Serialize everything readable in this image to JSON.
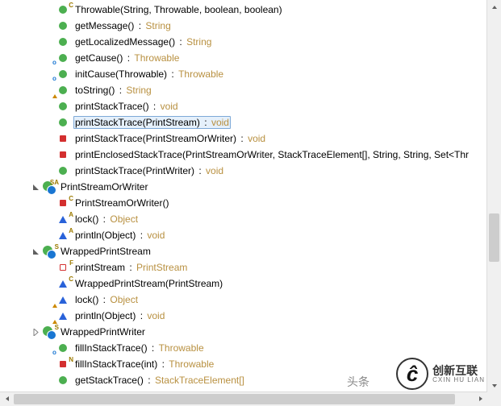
{
  "items": [
    {
      "indent": 3,
      "expand": "",
      "icons": [
        {
          "t": "green",
          "sup": "C"
        }
      ],
      "name": "Throwable(String, Throwable, boolean, boolean)",
      "ret": ""
    },
    {
      "indent": 3,
      "expand": "",
      "icons": [
        {
          "t": "green"
        }
      ],
      "name": "getMessage()",
      "ret": "String"
    },
    {
      "indent": 3,
      "expand": "",
      "icons": [
        {
          "t": "green"
        }
      ],
      "name": "getLocalizedMessage()",
      "ret": "String"
    },
    {
      "indent": 3,
      "expand": "",
      "icons": [
        {
          "t": "green",
          "subO": true
        }
      ],
      "name": "getCause()",
      "ret": "Throwable"
    },
    {
      "indent": 3,
      "expand": "",
      "icons": [
        {
          "t": "green",
          "subO": true
        }
      ],
      "name": "initCause(Throwable)",
      "ret": "Throwable"
    },
    {
      "indent": 3,
      "expand": "",
      "icons": [
        {
          "t": "green",
          "subTri": true
        }
      ],
      "name": "toString()",
      "ret": "String"
    },
    {
      "indent": 3,
      "expand": "",
      "icons": [
        {
          "t": "green"
        }
      ],
      "name": "printStackTrace()",
      "ret": "void"
    },
    {
      "indent": 3,
      "expand": "",
      "icons": [
        {
          "t": "green"
        }
      ],
      "name": "printStackTrace(PrintStream)",
      "ret": "void",
      "selected": true
    },
    {
      "indent": 3,
      "expand": "",
      "icons": [
        {
          "t": "red"
        }
      ],
      "name": "printStackTrace(PrintStreamOrWriter)",
      "ret": "void"
    },
    {
      "indent": 3,
      "expand": "",
      "icons": [
        {
          "t": "red"
        }
      ],
      "name": "printEnclosedStackTrace(PrintStreamOrWriter, StackTraceElement[], String, String, Set<Thr",
      "ret": ""
    },
    {
      "indent": 3,
      "expand": "",
      "icons": [
        {
          "t": "green"
        }
      ],
      "name": "printStackTrace(PrintWriter)",
      "ret": "void"
    },
    {
      "indent": 2,
      "expand": "open",
      "icons": [
        {
          "t": "class",
          "sup": "SA"
        }
      ],
      "name": "PrintStreamOrWriter",
      "ret": ""
    },
    {
      "indent": 3,
      "expand": "",
      "icons": [
        {
          "t": "red",
          "sup": "C"
        }
      ],
      "name": "PrintStreamOrWriter()",
      "ret": ""
    },
    {
      "indent": 3,
      "expand": "",
      "icons": [
        {
          "t": "bluetri",
          "sup": "A"
        }
      ],
      "name": "lock()",
      "ret": "Object"
    },
    {
      "indent": 3,
      "expand": "",
      "icons": [
        {
          "t": "bluetri",
          "sup": "A"
        }
      ],
      "name": "println(Object)",
      "ret": "void"
    },
    {
      "indent": 2,
      "expand": "open",
      "icons": [
        {
          "t": "class",
          "sup": "S"
        }
      ],
      "name": "WrappedPrintStream",
      "ret": ""
    },
    {
      "indent": 3,
      "expand": "",
      "icons": [
        {
          "t": "redsq",
          "sup": "F"
        }
      ],
      "name": "printStream",
      "ret": "PrintStream"
    },
    {
      "indent": 3,
      "expand": "",
      "icons": [
        {
          "t": "bluetri",
          "sup": "C"
        }
      ],
      "name": "WrappedPrintStream(PrintStream)",
      "ret": ""
    },
    {
      "indent": 3,
      "expand": "",
      "icons": [
        {
          "t": "bluetri",
          "subTri": true
        }
      ],
      "name": "lock()",
      "ret": "Object"
    },
    {
      "indent": 3,
      "expand": "",
      "icons": [
        {
          "t": "bluetri",
          "subTri": true
        }
      ],
      "name": "println(Object)",
      "ret": "void"
    },
    {
      "indent": 2,
      "expand": "closed",
      "icons": [
        {
          "t": "class",
          "sup": "S"
        }
      ],
      "name": "WrappedPrintWriter",
      "ret": ""
    },
    {
      "indent": 3,
      "expand": "",
      "icons": [
        {
          "t": "green",
          "subO": true
        }
      ],
      "name": "fillInStackTrace()",
      "ret": "Throwable"
    },
    {
      "indent": 3,
      "expand": "",
      "icons": [
        {
          "t": "red",
          "sup": "N"
        }
      ],
      "name": "fillInStackTrace(int)",
      "ret": "Throwable"
    },
    {
      "indent": 3,
      "expand": "",
      "icons": [
        {
          "t": "green"
        }
      ],
      "name": "getStackTrace()",
      "ret": "StackTraceElement[]"
    }
  ],
  "watermark": "头条",
  "logo": {
    "text": "创新互联",
    "sub": "CXIN HU LIAN"
  }
}
